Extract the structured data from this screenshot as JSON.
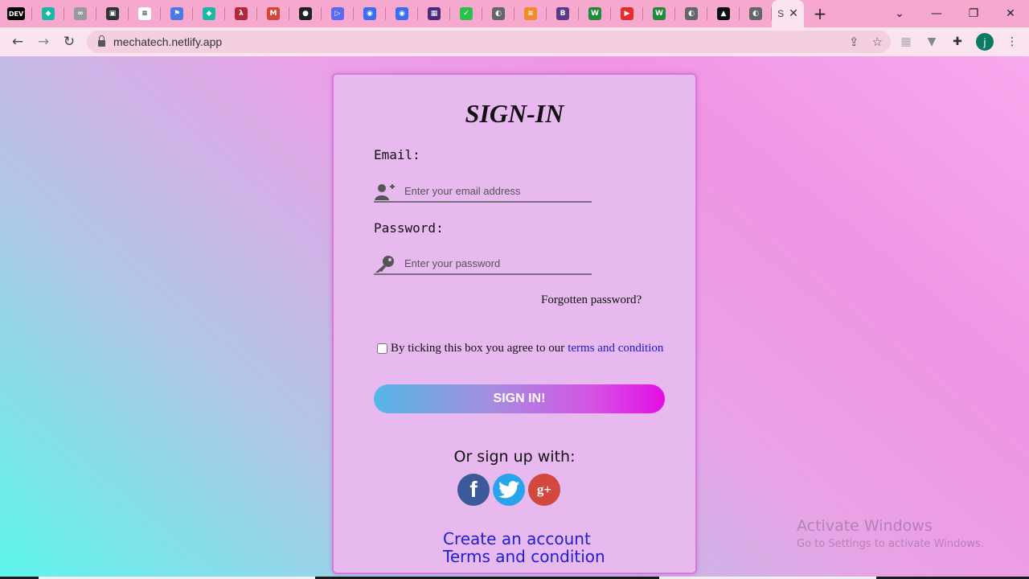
{
  "browser": {
    "tabs": [
      {
        "icon": "dev-icon",
        "color": "#000000",
        "glyph": "DEV"
      },
      {
        "icon": "diamond-icon",
        "color": "#17b8a6",
        "glyph": "◆"
      },
      {
        "icon": "infinity-icon",
        "color": "#9a9a9a",
        "glyph": "∞"
      },
      {
        "icon": "camera-icon",
        "color": "#333333",
        "glyph": "▣"
      },
      {
        "icon": "note-icon",
        "color": "#ffffff",
        "glyph": "≡"
      },
      {
        "icon": "flag-icon",
        "color": "#4a7be0",
        "glyph": "⚑"
      },
      {
        "icon": "diamond-icon",
        "color": "#17b8a6",
        "glyph": "◆"
      },
      {
        "icon": "figure-icon",
        "color": "#b0283a",
        "glyph": "λ"
      },
      {
        "icon": "gmail-icon",
        "color": "#d44638",
        "glyph": "M"
      },
      {
        "icon": "github-icon",
        "color": "#222222",
        "glyph": "●"
      },
      {
        "icon": "play-icon",
        "color": "#5a6bf0",
        "glyph": "▷"
      },
      {
        "icon": "circle-icon",
        "color": "#3a6cf0",
        "glyph": "◉"
      },
      {
        "icon": "circle-icon",
        "color": "#3a6cf0",
        "glyph": "◉"
      },
      {
        "icon": "colorful-icon",
        "color": "#4b2a7a",
        "glyph": "▦"
      },
      {
        "icon": "check-icon",
        "color": "#2bbf4b",
        "glyph": "✓"
      },
      {
        "icon": "globe-icon",
        "color": "#666666",
        "glyph": "◐"
      },
      {
        "icon": "stack-icon",
        "color": "#f08a2a",
        "glyph": "≋"
      },
      {
        "icon": "b-icon",
        "color": "#5a3a8a",
        "glyph": "B"
      },
      {
        "icon": "w-icon",
        "color": "#1e8a3a",
        "glyph": "W"
      },
      {
        "icon": "youtube-icon",
        "color": "#e52b2b",
        "glyph": "▶"
      },
      {
        "icon": "w-icon",
        "color": "#1e8a3a",
        "glyph": "W"
      },
      {
        "icon": "globe-icon",
        "color": "#666666",
        "glyph": "◐"
      },
      {
        "icon": "triangle-icon",
        "color": "#111111",
        "glyph": "▲"
      },
      {
        "icon": "globe-icon",
        "color": "#666666",
        "glyph": "◐"
      }
    ],
    "active_tab_title": "S",
    "url": "mechatech.netlify.app",
    "profile_initial": "j"
  },
  "page": {
    "title": "SIGN-IN",
    "email_label": "Email:",
    "email_placeholder": "Enter your email address",
    "password_label": "Password:",
    "password_placeholder": "Enter your password",
    "forgot": "Forgotten password?",
    "agree_text": "By ticking this box you agree to our",
    "agree_link": "terms and condition",
    "signin_button": "SIGN IN!",
    "or_sign_up": "Or sign up with:",
    "social": {
      "facebook": "f",
      "google_plus": "g+"
    },
    "create_account": "Create an account",
    "terms": "Terms and condition"
  },
  "watermark": {
    "line1": "Activate Windows",
    "line2": "Go to Settings to activate Windows."
  },
  "colors": {
    "card_bg": "#e8b9ef",
    "button_start": "#55b6e6",
    "button_end": "#e40ee6",
    "link": "#2020d0"
  }
}
